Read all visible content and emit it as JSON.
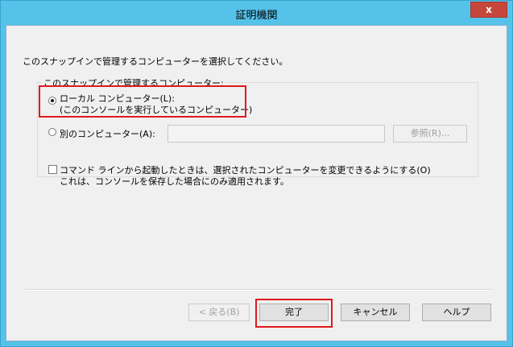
{
  "window": {
    "title": "証明機関",
    "close_label": "x"
  },
  "dialog": {
    "instruction": "このスナップインで管理するコンピューターを選択してください。",
    "group_label": "このスナップインで管理するコンピューター:",
    "local_option_line1": "ローカル コンピューター(L):",
    "local_option_line2": "(このコンソールを実行しているコンピューター)",
    "other_option_label": "別のコンピューター(A):",
    "other_computer_value": "",
    "browse_label": "参照(R)...",
    "checkbox_label": "コマンド ラインから起動したときは、選択されたコンピューターを変更できるようにする(O)",
    "checkbox_note": "これは、コンソールを保存した場合にのみ適用されます。",
    "local_selected": true,
    "checkbox_checked": false
  },
  "buttons": {
    "back": "< 戻る(B)",
    "finish": "完了",
    "cancel": "キャンセル",
    "help": "ヘルプ"
  },
  "colors": {
    "titlebar": "#55c2ea",
    "close": "#c7463c",
    "highlight": "#e0191c"
  }
}
